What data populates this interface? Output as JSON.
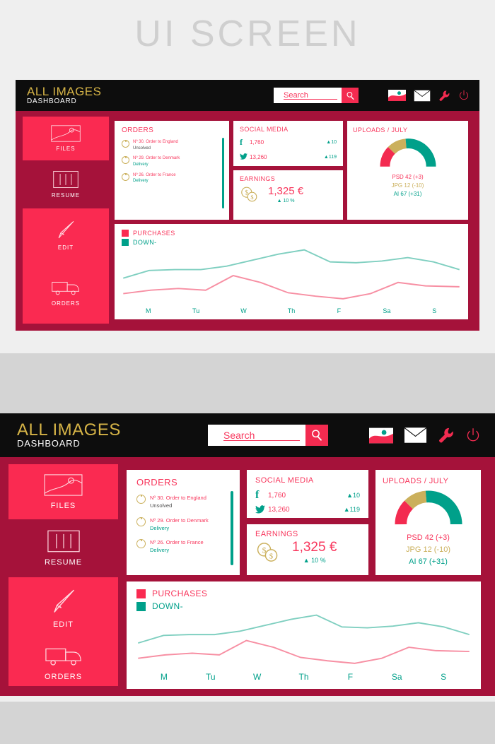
{
  "page": {
    "title": "UI SCREEN",
    "background": "#efefef",
    "footer_color": "#d4d4d4"
  },
  "colors": {
    "pink": "#fa2a51",
    "pink_text": "#f8365c",
    "dark_red": "#a5123a",
    "teal": "#00a08a",
    "gold": "#cbb05c",
    "brand_gold": "#d6b447",
    "header_black": "#0d0d0d",
    "white": "#ffffff"
  },
  "header": {
    "brand_line1": "ALL IMAGES",
    "brand_line2": "DASHBOARD",
    "search": {
      "placeholder": "Search",
      "value": "",
      "button_icon": "search-icon"
    },
    "icons": [
      {
        "name": "image-icon",
        "label": "Images"
      },
      {
        "name": "mail-icon",
        "label": "Mail"
      },
      {
        "name": "wrench-icon",
        "label": "Settings"
      },
      {
        "name": "power-icon",
        "label": "Logout"
      }
    ]
  },
  "sidebar": {
    "items": [
      {
        "label": "FILES",
        "icon": "image-file-icon",
        "active": false
      },
      {
        "label": "RESUME",
        "icon": "columns-icon",
        "active": true
      },
      {
        "label": "EDIT",
        "icon": "pen-icon",
        "active": false
      },
      {
        "label": "ORDERS",
        "icon": "truck-icon",
        "active": false
      }
    ]
  },
  "orders_card": {
    "title": "ORDERS",
    "items": [
      {
        "line1": "Nº 30. Order to England",
        "line2": "Unsolved",
        "status": "unsolved"
      },
      {
        "line1": "Nº 29. Order to Denmark",
        "line2": "Delivery",
        "status": "delivery"
      },
      {
        "line1": "Nº 26. Order to France",
        "line2": "Delivery",
        "status": "delivery"
      }
    ]
  },
  "social_card": {
    "title": "SOCIAL MEDIA",
    "rows": [
      {
        "icon": "facebook-icon",
        "glyph": "f",
        "value": "1,760",
        "delta": "▲10"
      },
      {
        "icon": "twitter-icon",
        "glyph": "t",
        "value": "13,260",
        "delta": "▲119"
      }
    ]
  },
  "earnings_card": {
    "title": "EARNINGS",
    "icon": "coins-icon",
    "value": "1,325 €",
    "delta": "▲ 10 %"
  },
  "uploads_card": {
    "title": "UPLOADS / JULY",
    "legend": [
      {
        "label": "PSD 42  (+3)",
        "color": "#f8365c"
      },
      {
        "label": "JPG 12  (-10)",
        "color": "#cbb05c"
      },
      {
        "label": "AI 67  (+31)",
        "color": "#00a08a"
      }
    ],
    "gauge": {
      "type": "arc",
      "segments": [
        {
          "name": "PSD",
          "color": "#f32b50",
          "value": 42,
          "start_deg": 0,
          "end_deg": 55
        },
        {
          "name": "JPG",
          "color": "#cbb05c",
          "value": 12,
          "start_deg": 55,
          "end_deg": 95
        },
        {
          "name": "AI",
          "color": "#00a08a",
          "value": 67,
          "start_deg": 95,
          "end_deg": 180
        }
      ]
    }
  },
  "chart_card": {
    "legend": [
      {
        "label": "PURCHASES",
        "color": "#fa2a51"
      },
      {
        "label": "DOWN-",
        "color": "#00a08a"
      }
    ]
  },
  "chart_data": {
    "type": "line",
    "title": "",
    "xlabel": "",
    "ylabel": "",
    "categories": [
      "M",
      "Tu",
      "W",
      "Th",
      "F",
      "Sa",
      "S"
    ],
    "x_tick_labels": [
      "M",
      "Tu",
      "W",
      "Th",
      "F",
      "Sa",
      "S"
    ],
    "grid": false,
    "legend_position": "top-left",
    "ylim": [
      0,
      100
    ],
    "series": [
      {
        "name": "PURCHASES",
        "color": "#fa2a51",
        "values": [
          22,
          32,
          27,
          26,
          55,
          40,
          24,
          18,
          14,
          22,
          40,
          35,
          33
        ]
      },
      {
        "name": "DOWN-",
        "color": "#00a08a",
        "values": [
          48,
          58,
          60,
          60,
          64,
          72,
          80,
          88,
          71,
          70,
          72,
          76,
          70,
          54
        ]
      }
    ]
  }
}
